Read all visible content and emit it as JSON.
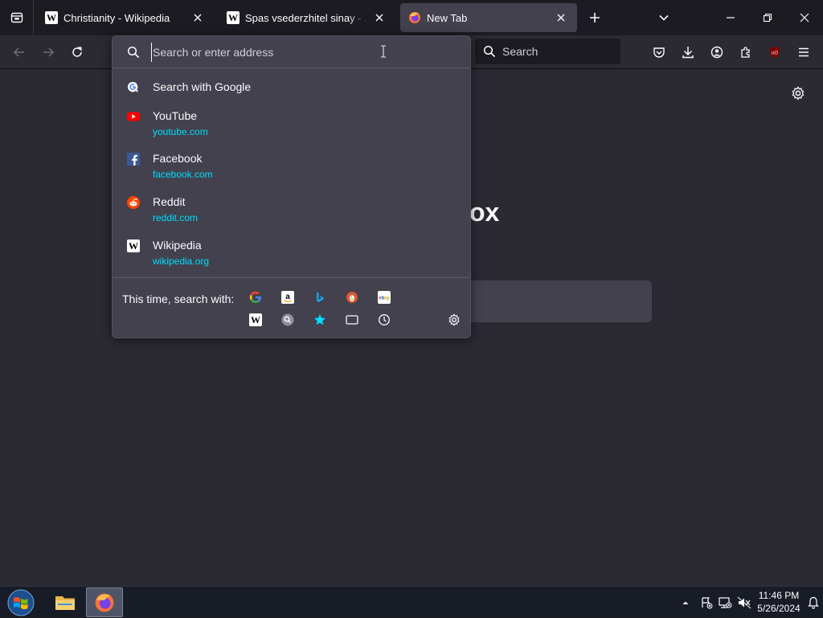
{
  "tabs": [
    {
      "title": "Christianity - Wikipedia",
      "icon": "wikipedia-icon",
      "active": false
    },
    {
      "title": "Spas vsederzhitel sinay - Jesus - Wikipedia",
      "icon": "wikipedia-icon",
      "active": false
    },
    {
      "title": "New Tab",
      "icon": "firefox-icon",
      "active": true
    }
  ],
  "toolbar": {
    "search_placeholder": "Search"
  },
  "urlbar": {
    "placeholder": "Search or enter address",
    "value": ""
  },
  "suggestions": [
    {
      "title": "Search with Google",
      "url": "",
      "icon": "google-icon"
    },
    {
      "title": "YouTube",
      "url": "youtube.com",
      "icon": "youtube-icon"
    },
    {
      "title": "Facebook",
      "url": "facebook.com",
      "icon": "facebook-icon"
    },
    {
      "title": "Reddit",
      "url": "reddit.com",
      "icon": "reddit-icon"
    },
    {
      "title": "Wikipedia",
      "url": "wikipedia.org",
      "icon": "wikipedia-icon"
    }
  ],
  "one_off": {
    "label": "This time, search with:",
    "engines": [
      "google-icon",
      "amazon-icon",
      "bing-icon",
      "duckduckgo-icon",
      "ebay-icon",
      "wikipedia-icon",
      "search-engine-icon",
      "bookmarks-icon",
      "tabs-icon",
      "history-icon"
    ]
  },
  "newtab": {
    "wordmark": "ox"
  },
  "taskbar": {
    "time": "11:46 PM",
    "date": "5/26/2024"
  },
  "colors": {
    "accent_link": "#00ddff",
    "popup_bg": "#42414d",
    "toolbar_bg": "#2b2a33",
    "tabbar_bg": "#1c1b22"
  }
}
